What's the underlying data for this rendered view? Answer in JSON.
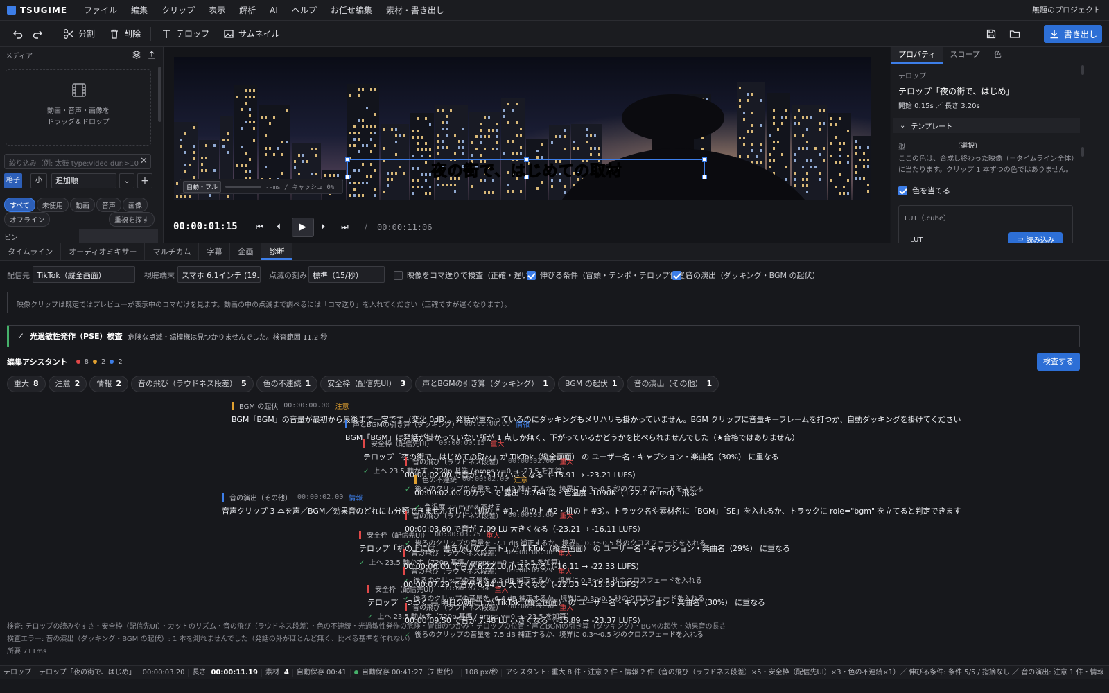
{
  "app": {
    "name": "TSUGIME",
    "project": "無題のプロジェクト"
  },
  "menu": [
    "ファイル",
    "編集",
    "クリップ",
    "表示",
    "解析",
    "AI",
    "ヘルプ",
    "お任せ編集",
    "素材・書き出し"
  ],
  "toolbar": {
    "split": "分割",
    "delete": "削除",
    "telop": "テロップ",
    "thumbnail": "サムネイル",
    "export": "書き出し"
  },
  "media": {
    "title": "メディア",
    "drop_line1": "動画・音声・画像を",
    "drop_line2": "ドラッグ＆ドロップ",
    "filter_placeholder": "絞り込み（例: 太鼓 type:video dur:>10",
    "view": "格子",
    "size": "小",
    "sort": "追加順",
    "chips": [
      "すべて",
      "未使用",
      "動画",
      "音声",
      "画像"
    ],
    "chips2": [
      "オフライン"
    ],
    "find_dup": "重複を探す",
    "bin": "ビン"
  },
  "preview": {
    "caption": "夜の街で、はじめての取材",
    "mode": "自動・フル",
    "perf": "--ms / キャッシュ 0%",
    "current": "00:00:01:15",
    "sep": "/",
    "duration": "00:00:11:06"
  },
  "props": {
    "tabs": [
      "プロパティ",
      "スコープ",
      "色"
    ],
    "section": "テロップ",
    "clip": "テロップ「夜の街で、はじめ」",
    "timing": "開始 0.15s ／ 長さ 3.20s",
    "template": "テンプレート",
    "row_label": "型",
    "row_value": "（選択）",
    "note": "ここの色は、合成し終わった映像（＝タイムライン全体）に当たります。クリップ 1 本ずつの色ではありません。",
    "apply_color": "色を当てる",
    "lut_title": "LUT（.cube）",
    "lut_label": "LUT",
    "lut_load": "読み込み"
  },
  "bottom_tabs": [
    "タイムライン",
    "オーディオミキサー",
    "マルチカム",
    "字幕",
    "企画",
    "診断"
  ],
  "diag": {
    "dest_label": "配信先",
    "dest": "TikTok（縦全画面）",
    "device_label": "視聴端末",
    "device": "スマホ 6.1インチ (19.5:9)",
    "flicker_label": "点滅の刻み",
    "flicker": "標準（15/秒）",
    "opt1": "映像をコマ送りで検査（正確・遅い）",
    "opt2": "伸びる条件（冒頭・テンポ・テロップ位置）",
    "opt3": "音の演出（ダッキング・BGM の起伏）",
    "info": "映像クリップは既定ではプレビューが表示中のコマだけを見ます。動画の中の点滅まで調べるには「コマ送り」を入れてください（正確ですが遅くなります）。",
    "pse_title": "光過敏性発作（PSE）検査",
    "pse_msg": "危険な点滅・縞模様は見つかりませんでした。検査範囲 11.2 秒",
    "assistant": "編集アシスタント",
    "counts": [
      "8",
      "2",
      "2"
    ],
    "check_btn": "検査する",
    "categories": [
      {
        "label": "重大",
        "n": "8"
      },
      {
        "label": "注意",
        "n": "2"
      },
      {
        "label": "情報",
        "n": "2"
      },
      {
        "label": "音の飛び（ラウドネス段差）",
        "n": "5"
      },
      {
        "label": "色の不連続",
        "n": "1"
      },
      {
        "label": "安全枠（配信先UI）",
        "n": "3"
      },
      {
        "label": "声とBGMの引き算（ダッキング）",
        "n": "1"
      },
      {
        "label": "BGM の起伏",
        "n": "1"
      },
      {
        "label": "音の演出（その他）",
        "n": "1"
      }
    ],
    "footer1": "検査: テロップの読みやすさ・安全枠（配信先UI）・カットのリズム・音の飛び（ラウドネス段差）・色の不連続・光過敏性発作の危険・冒頭のつかみ・テロップの位置・声とBGMの引き算（ダッキング）・BGMの起伏・効果音の長さ",
    "footer2": "検査エラー: 音の演出（ダッキング・BGM の起伏）: 1 本を測れませんでした（発話の外がほとんど無く、比べる基準を作れない）",
    "footer3": "所要 711ms"
  },
  "issues": [
    {
      "cat": "BGM の起伏",
      "ts": "00:00:00.00",
      "sev": "注意",
      "color": "#e0a030",
      "body": "BGM「BGM」の音量が最初から最後まで一定です（変化 0dB）。発話が重なっているのにダッキングもメリハリも掛かっていません。BGM クリップに音量キーフレームを打つか、自動ダッキングを掛けてください",
      "fix": ""
    },
    {
      "cat": "声とBGMの引き算（ダッキング）",
      "ts": "00:00:00.00",
      "sev": "情報",
      "color": "#3d7ee8",
      "body": "BGM「BGM」は発話が掛かっていない所が 1 点しか無く、下がっているかどうかを比べられませんでした（★合格ではありません）",
      "fix": ""
    },
    {
      "cat": "安全枠（配信先UI）",
      "ts": "00:00:00.15",
      "sev": "重大",
      "color": "#e04848",
      "body": "テロップ「夜の街で、はじめての取材」が TikTok（縦全画面） の ユーザー名・キャプション・楽曲名（30%） に重なる",
      "fix": "上へ 23.5 動かす（720p 基準 / props.y=0 → -23.5 を加算）"
    },
    {
      "cat": "音の飛び（ラウドネス段差）",
      "ts": "00:00:02.00",
      "sev": "重大",
      "color": "#e04848",
      "body": "00:00:02.00 で音が 7.5 LU 小さくなる（-15.91 → -23.21 LUFS）",
      "fix": "後ろのクリップの音量を 7.1 dB 補正するか、境界に 0.3〜0.5 秒のクロスフェードを入れる"
    },
    {
      "cat": "色の不連続",
      "ts": "00:00:02.00",
      "sev": "注意",
      "color": "#e0a030",
      "body": "00:00:02.00 のカットで 露出 -0.764 段・色温度 -1090K（+22.1 mired） 飛ぶ",
      "fix": "色温度 22 mired 寄せる"
    },
    {
      "cat": "音の演出（その他）",
      "ts": "00:00:02.00",
      "sev": "情報",
      "color": "#3d7ee8",
      "body": "音声クリップ 3 本を声／BGM／効果音のどれにも分類できませんでした（机の上 #1・机の上 #2・机の上 #3）。トラック名や素材名に「BGM」「SE」を入れるか、トラックに role=\"bgm\" を立てると判定できます",
      "fix": ""
    },
    {
      "cat": "音の飛び（ラウドネス段差）",
      "ts": "00:00:03.60",
      "sev": "重大",
      "color": "#e04848",
      "body": "00:00:03.60 で音が 7.09 LU 大きくなる（-23.21 → -16.11 LUFS）",
      "fix": "後ろのクリップの音量を -7.1 dB 補正するか、境界に 0.3〜0.5 秒のクロスフェードを入れる"
    },
    {
      "cat": "安全枠（配信先UI）",
      "ts": "00:00:03.75",
      "sev": "重大",
      "color": "#e04848",
      "body": "テロップ「机の上には、書きかけのノート」が TikTok（縦全画面） の ユーザー名・キャプション・楽曲名（29%） に重なる",
      "fix": "上へ 23.5 動かす（720p 基準 / props.y=0 → -23.5 を加算）"
    },
    {
      "cat": "音の飛び（ラウドネス段差）",
      "ts": "00:00:06.00",
      "sev": "重大",
      "color": "#e04848",
      "body": "00:00:06.00 で音が 6.22 LU 小さくなる（-16.11 → -22.33 LUFS）",
      "fix": "後ろのクリップの音量を 6.2 dB 補正するか、境界に 0.3〜0.5 秒のクロスフェードを入れる"
    },
    {
      "cat": "音の飛び（ラウドネス段差）",
      "ts": "00:00:07.29",
      "sev": "重大",
      "color": "#e04848",
      "body": "00:00:07.29 で音が 6.44 LU 大きくなる（-22.33 → -15.89 LUFS）",
      "fix": "後ろのクリップの音量を -6.4 dB 補正するか、境界に 0.3〜0.5 秒のクロスフェードを入れる"
    },
    {
      "cat": "安全枠（配信先UI）",
      "ts": "00:00:07.54",
      "sev": "重大",
      "color": "#e04848",
      "body": "テロップ「つづく — 明日の朝に」が TikTok（縦全画面） の ユーザー名・キャプション・楽曲名（30%） に重なる",
      "fix": "上へ 23.5 動かす（720p 基準 / props.y=0 → -23.5 を加算）"
    },
    {
      "cat": "音の飛び（ラウドネス段差）",
      "ts": "00:00:09.50",
      "sev": "重大",
      "color": "#e04848",
      "body": "00:00:09.50 で音が 7.48 LU 小さくなる（-15.89 → -23.37 LUFS）",
      "fix": "後ろのクリップの音量を 7.5 dB 補正するか、境界に 0.3〜0.5 秒のクロスフェードを入れる"
    }
  ],
  "status": [
    "テロップ",
    "テロップ「夜の街で、はじめ」",
    "00:00:03.20",
    "長さ",
    "00:00:11.19",
    "素材",
    "4",
    "自動保存 00:41",
    "自動保存 00:41:27（7 世代）",
    "108 px/秒",
    "アシスタント: 重大 8 件・注意 2 件・情報 2 件（音の飛び（ラウドネス段差）×5・安全枠（配信先UI）×3・色の不連続×1）／ 伸びる条件: 条件 5/5 / 指摘なし ／ 音の演出: 注意 1 件・情報"
  ],
  "colors": {
    "accent": "#3d7ee8",
    "critical": "#e04848",
    "warning": "#e0a030",
    "info": "#3d7ee8",
    "ok": "#46b06a"
  }
}
